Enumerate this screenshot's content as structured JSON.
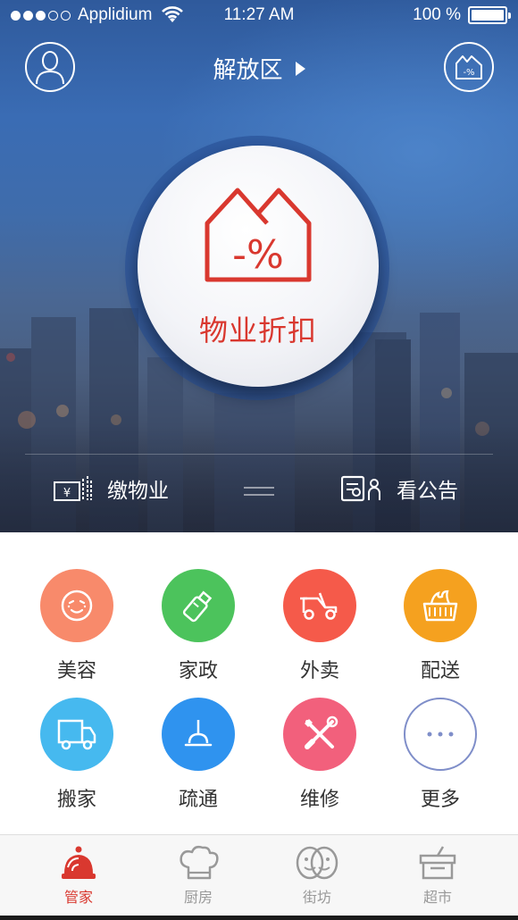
{
  "status_bar": {
    "carrier": "Applidium",
    "time": "11:27 AM",
    "battery": "100 %",
    "battery_level": 1.0,
    "signal_bars_filled": 3,
    "signal_bars_total": 5
  },
  "header": {
    "location": "解放区",
    "avatar_icon": "user-avatar-icon",
    "right_icon": "house-discount-icon"
  },
  "hero": {
    "main_button_label": "物业折扣",
    "main_button_icon": "house-discount-icon",
    "main_button_icon_text": "-%",
    "left_action": {
      "label": "缴物业",
      "icon": "property-fee-icon"
    },
    "right_action": {
      "label": "看公告",
      "icon": "notice-icon"
    }
  },
  "services": [
    {
      "label": "美容",
      "icon": "face-icon",
      "color": "#f88a6b"
    },
    {
      "label": "家政",
      "icon": "spray-bottle-icon",
      "color": "#4cc35c"
    },
    {
      "label": "外卖",
      "icon": "scooter-icon",
      "color": "#f55a4a"
    },
    {
      "label": "配送",
      "icon": "basket-icon",
      "color": "#f5a11f"
    },
    {
      "label": "搬家",
      "icon": "truck-icon",
      "color": "#46b9ef"
    },
    {
      "label": "疏通",
      "icon": "plunger-icon",
      "color": "#2f93ef"
    },
    {
      "label": "维修",
      "icon": "tools-icon",
      "color": "#f2607c"
    },
    {
      "label": "更多",
      "icon": "more-dots-icon",
      "color": "#7f8ec9"
    }
  ],
  "tabs": [
    {
      "label": "管家",
      "icon": "butler-bell-icon",
      "active": true
    },
    {
      "label": "厨房",
      "icon": "chef-hat-icon",
      "active": false
    },
    {
      "label": "街坊",
      "icon": "neighbors-icon",
      "active": false
    },
    {
      "label": "超市",
      "icon": "shop-basket-icon",
      "active": false
    }
  ],
  "colors": {
    "accent": "#d9382f",
    "tab_inactive": "#999999",
    "hero_blue": "#3a6cb4"
  }
}
